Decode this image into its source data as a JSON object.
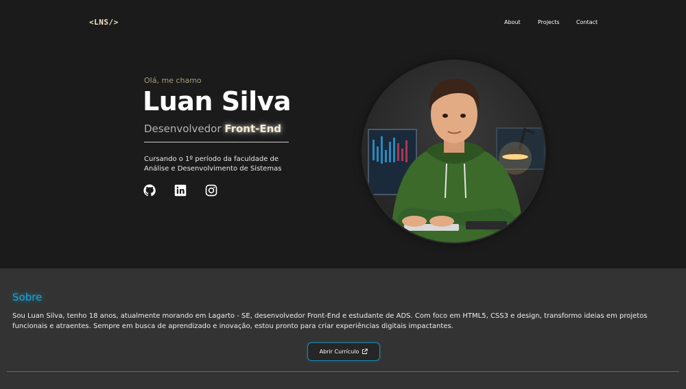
{
  "header": {
    "logo": "<LNS/>",
    "nav": [
      "About",
      "Projects",
      "Contact"
    ]
  },
  "hero": {
    "greeting": "Olá, me chamo",
    "name": "Luan Silva",
    "role_prefix": "Desenvolvedor",
    "role_highlight": "Front-End",
    "study_line1": "Cursando o 1º período da faculdade de",
    "study_line2": "Análise e Desenvolvimento de Sistemas",
    "social_icons": [
      "github-icon",
      "linkedin-icon",
      "instagram-icon"
    ]
  },
  "about": {
    "title": "Sobre",
    "text": "Sou Luan Silva, tenho 18 anos, atualmente morando em Lagarto - SE, desenvolvedor Front-End e estudante de ADS. Com foco em HTML5, CSS3 e design, transformo ideias em projetos funcionais e atraentes. Sempre em busca de aprendizado e inovação, estou pronto para criar experiências digitais impactantes.",
    "button_label": "Abrir Currículo",
    "button_icon": "external-link-icon"
  },
  "colors": {
    "background": "#1b1b1b",
    "section": "#333333",
    "accent": "#1aa3d6",
    "logo": "#f3e6c8"
  }
}
